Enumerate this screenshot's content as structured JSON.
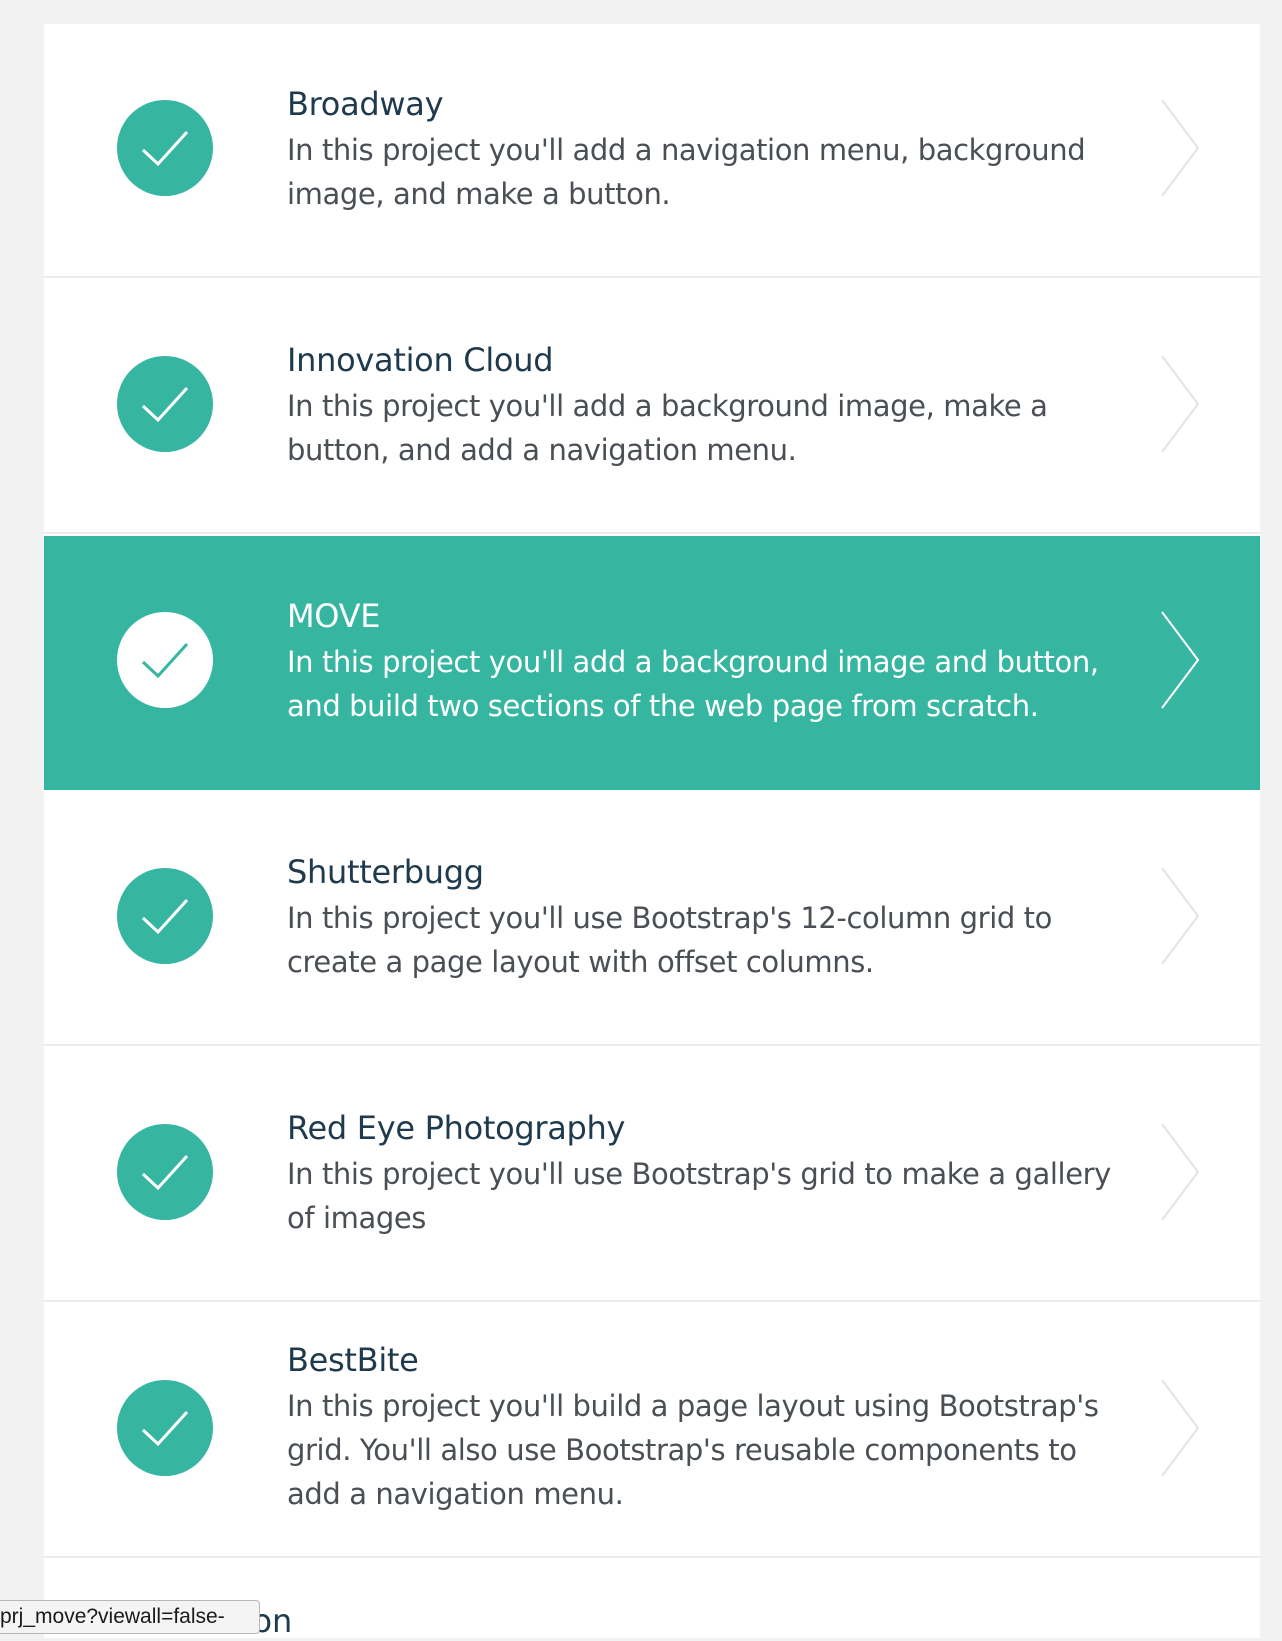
{
  "colors": {
    "accent": "#36b5a0",
    "title_text": "#1f3a4d",
    "body_text": "#4a4f55",
    "chevron_idle": "#e3e3e3"
  },
  "projects": [
    {
      "title": "Broadway",
      "description": "In this project you'll add a navigation menu, background image, and make a button.",
      "status_icon": "check-icon",
      "active": false
    },
    {
      "title": "Innovation Cloud",
      "description": "In this project you'll add a background image, make a button, and add a navigation menu.",
      "status_icon": "check-icon",
      "active": false
    },
    {
      "title": "MOVE",
      "description": "In this project you'll add a background image and button, and build two sections of the web page from scratch.",
      "status_icon": "check-icon",
      "active": true
    },
    {
      "title": "Shutterbugg",
      "description": "In this project you'll use Bootstrap's 12-column grid to create a page layout with offset columns.",
      "status_icon": "check-icon",
      "active": false
    },
    {
      "title": "Red Eye Photography",
      "description": "In this project you'll use Bootstrap's grid to make a gallery of images",
      "status_icon": "check-icon",
      "active": false
    },
    {
      "title": "BestBite",
      "description": "In this project you'll build a page layout using Bootstrap's grid. You'll also use Bootstrap's reusable components to add a navigation menu.",
      "status_icon": "check-icon",
      "active": false
    }
  ],
  "next_item_partial_title": "Ion",
  "status_bar": {
    "url_text": "-prj_move?viewall=false"
  }
}
